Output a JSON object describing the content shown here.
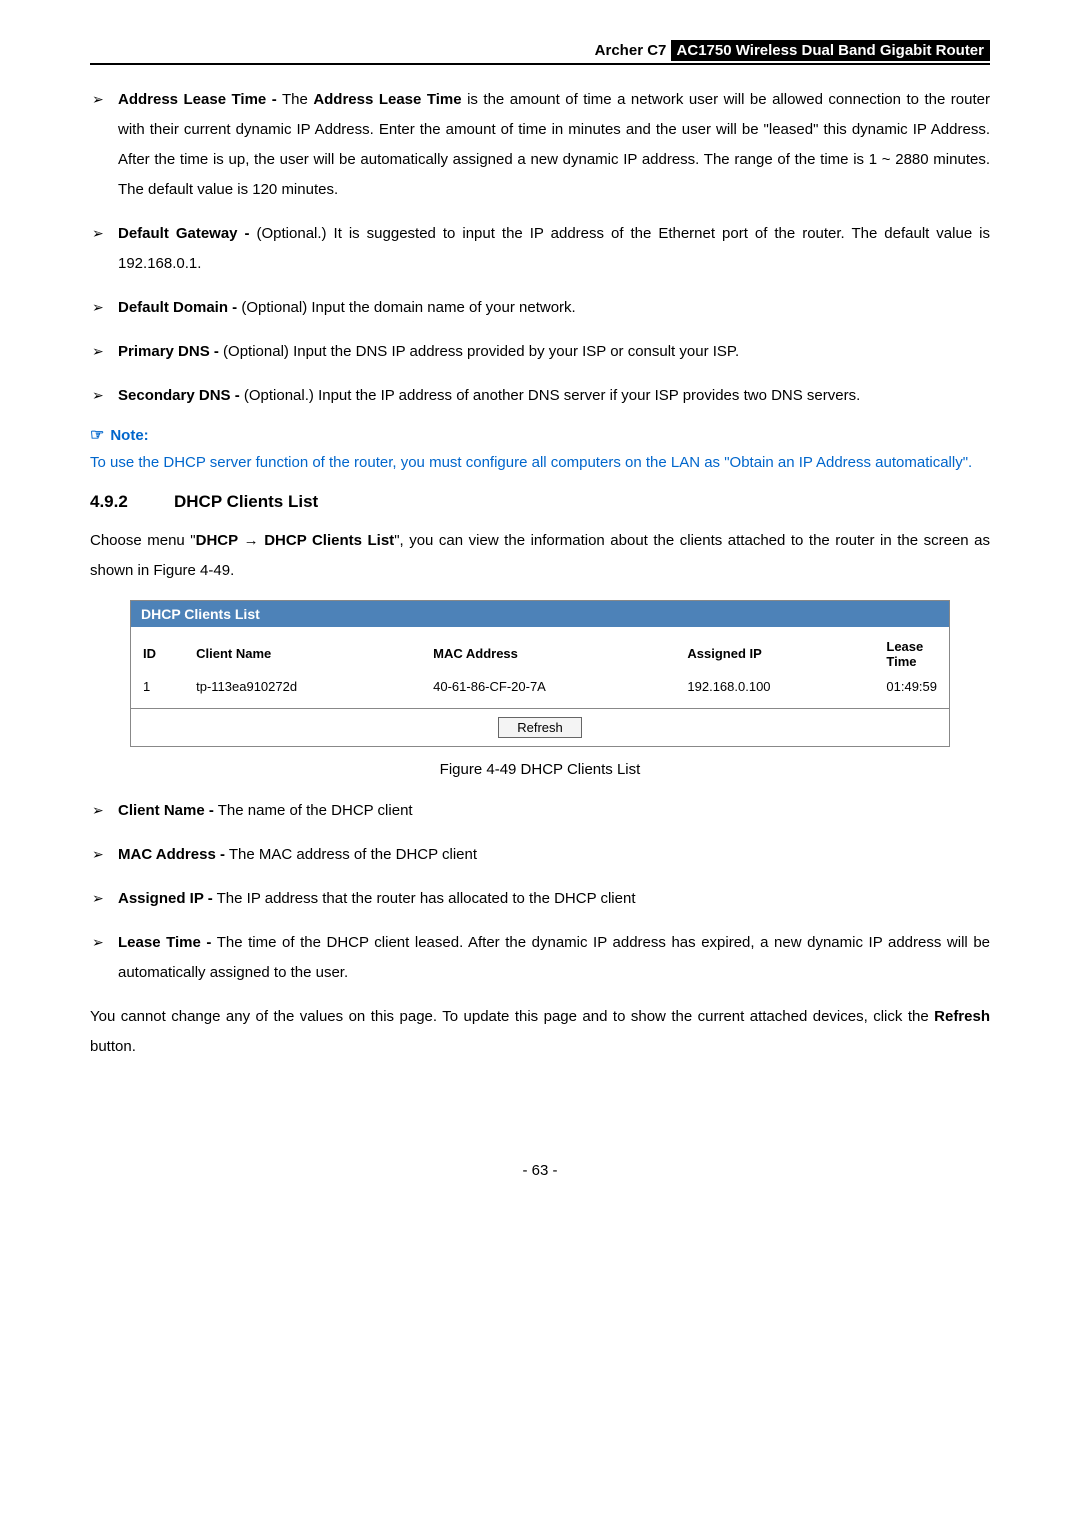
{
  "header": {
    "model": "Archer C7",
    "product": "AC1750 Wireless Dual Band Gigabit Router"
  },
  "bullets_top": [
    {
      "lead": "Address Lease Time -",
      "text_pre": " The ",
      "lead2": "Address Lease Time",
      "text": " is the amount of time a network user will be allowed connection to the router with their current dynamic IP Address. Enter the amount of time in minutes and the user will be \"leased\" this dynamic IP Address. After the time is up, the user will be automatically assigned a new dynamic IP address. The range of the time is 1 ~ 2880 minutes. The default value is 120 minutes."
    },
    {
      "lead": "Default Gateway -",
      "text": " (Optional.) It is suggested to input the IP address of the Ethernet port of the router. The default value is 192.168.0.1."
    },
    {
      "lead": "Default Domain -",
      "text": " (Optional) Input the domain name of your network."
    },
    {
      "lead": "Primary DNS -",
      "text": " (Optional) Input the DNS IP address provided by your ISP or consult your ISP."
    },
    {
      "lead": "Secondary DNS -",
      "text": " (Optional.) Input the IP address of another DNS server if your ISP provides two DNS servers."
    }
  ],
  "note": {
    "label": "Note:",
    "body": "To use the DHCP server function of the router, you must configure all computers on the LAN as \"Obtain an IP Address automatically\"."
  },
  "section": {
    "num": "4.9.2",
    "title": "DHCP Clients List"
  },
  "intro": {
    "pre": "Choose menu \"",
    "b1": "DHCP",
    "arrow": " → ",
    "b2": "DHCP Clients List",
    "post": "\", you can view the information about the clients attached to the router in the screen as shown in Figure 4-49."
  },
  "dhcp": {
    "panel_title": "DHCP Clients List",
    "headers": [
      "ID",
      "Client Name",
      "MAC Address",
      "Assigned IP",
      "Lease Time"
    ],
    "row": [
      "1",
      "tp-113ea910272d",
      "40-61-86-CF-20-7A",
      "192.168.0.100",
      "01:49:59"
    ],
    "refresh": "Refresh"
  },
  "figure_caption": "Figure 4-49 DHCP Clients List",
  "bullets_bottom": [
    {
      "lead": "Client Name -",
      "text": " The name of the DHCP client"
    },
    {
      "lead": "MAC Address -",
      "text": " The MAC address of the DHCP client"
    },
    {
      "lead": "Assigned IP -",
      "text": " The IP address that the router has allocated to the DHCP client"
    },
    {
      "lead": "Lease Time -",
      "text": " The time of the DHCP client leased. After the dynamic IP address has expired, a new dynamic IP address will be automatically assigned to the user."
    }
  ],
  "closing": {
    "pre": "You cannot change any of the values on this page. To update this page and to show the current attached devices, click the ",
    "b": "Refresh",
    "post": " button."
  },
  "page_number": "- 63 -"
}
